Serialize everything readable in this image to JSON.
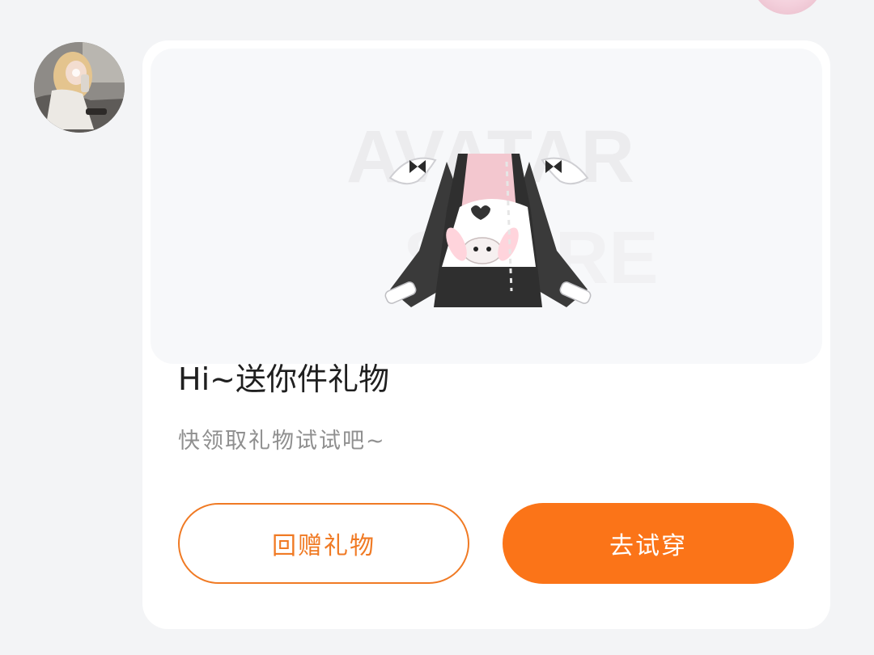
{
  "gift_card": {
    "title": "Hi~送你件礼物",
    "subtitle": "快领取礼物试试吧~",
    "watermark": [
      "AVATAR",
      "STORE"
    ],
    "buttons": {
      "return_gift": "回赠礼物",
      "try_on": "去试穿"
    }
  },
  "colors": {
    "accent": "#fb7418",
    "outline_accent": "#f07a24",
    "background": "#f3f4f6",
    "card": "#ffffff"
  },
  "icons": {
    "sender_avatar": "user-avatar-photo",
    "gift_item": "outfit-preview-image"
  }
}
